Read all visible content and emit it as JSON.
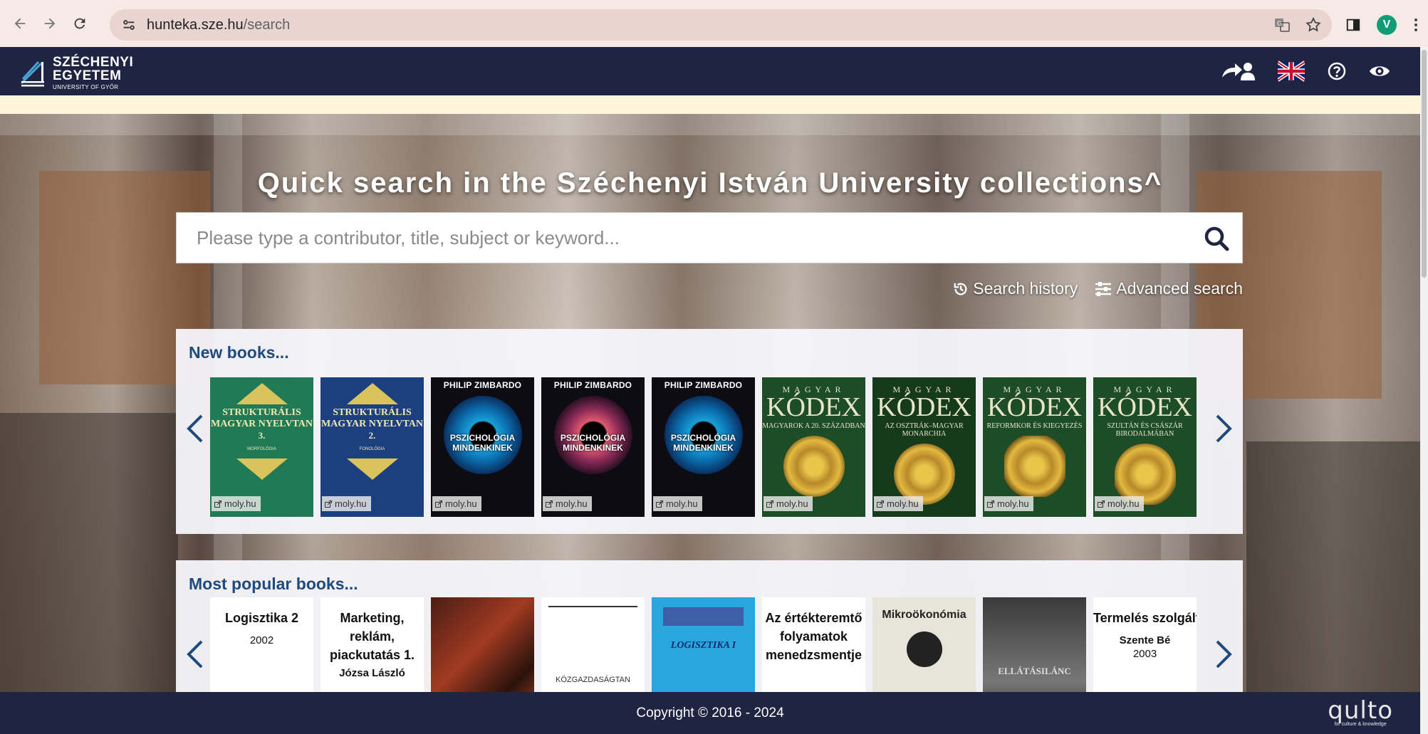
{
  "browser": {
    "url_host": "hunteka.sze.hu",
    "url_path": "/search",
    "avatar_letter": "V"
  },
  "header": {
    "logo_line1": "SZÉCHENYI",
    "logo_line2": "EGYETEM",
    "logo_line3": "UNIVERSITY OF GYŐR",
    "brand_color": "#1f2442"
  },
  "search": {
    "title": "Quick search in the Széchenyi István University collections^",
    "placeholder": "Please type a contributor, title, subject or keyword...",
    "history_label": "Search history",
    "advanced_label": "Advanced search"
  },
  "new_books": {
    "title": "New books...",
    "source_label": "moly.hu",
    "items": [
      {
        "title": "STRUKTURÁLIS MAGYAR NYELVTAN",
        "volume": "3.",
        "subtitle": "MORFOLÓGIA"
      },
      {
        "title": "STRUKTURÁLIS MAGYAR NYELVTAN",
        "volume": "2.",
        "subtitle": "FONOLÓGIA"
      },
      {
        "author": "PHILIP ZIMBARDO",
        "title": "PSZICHOLÓGIA MINDENKINEK"
      },
      {
        "author": "PHILIP ZIMBARDO",
        "title": "PSZICHOLÓGIA MINDENKINEK"
      },
      {
        "author": "PHILIP ZIMBARDO",
        "title": "PSZICHOLÓGIA MINDENKINEK"
      },
      {
        "series": "MAGYAR",
        "title": "KÓDEX",
        "subtitle": "MAGYAROK A 20. SZÁZADBAN"
      },
      {
        "series": "MAGYAR",
        "title": "KÓDEX",
        "subtitle": "AZ OSZTRÁK–MAGYAR MONARCHIA"
      },
      {
        "series": "MAGYAR",
        "title": "KÓDEX",
        "subtitle": "REFORMKOR ÉS KIEGYEZÉS"
      },
      {
        "series": "MAGYAR",
        "title": "KÓDEX",
        "subtitle": "SZULTÁN ÉS CSÁSZÁR BIRODALMÁBAN"
      }
    ]
  },
  "popular_books": {
    "title": "Most popular books...",
    "items": [
      {
        "title": "Logisztika 2",
        "year": "2002"
      },
      {
        "title": "Marketing, reklám, piackutatás 1.",
        "author": "Józsa László"
      },
      {
        "title": ""
      },
      {
        "title": "KÖZGAZDASÁGTAN"
      },
      {
        "title": "LOGISZTIKA I"
      },
      {
        "title": "Az értékteremtő folyamatok menedzsmentje"
      },
      {
        "title": "Mikroökonómia"
      },
      {
        "title": "ELLÁTÁSILÁNC"
      },
      {
        "title": "Termelés szolgáltatásmen",
        "author": "Szente Bé",
        "year": "2003"
      }
    ]
  },
  "footer": {
    "copyright": "Copyright © 2016 - 2024",
    "partner_logo": "qulto",
    "partner_tagline": "for culture & knowledge"
  }
}
